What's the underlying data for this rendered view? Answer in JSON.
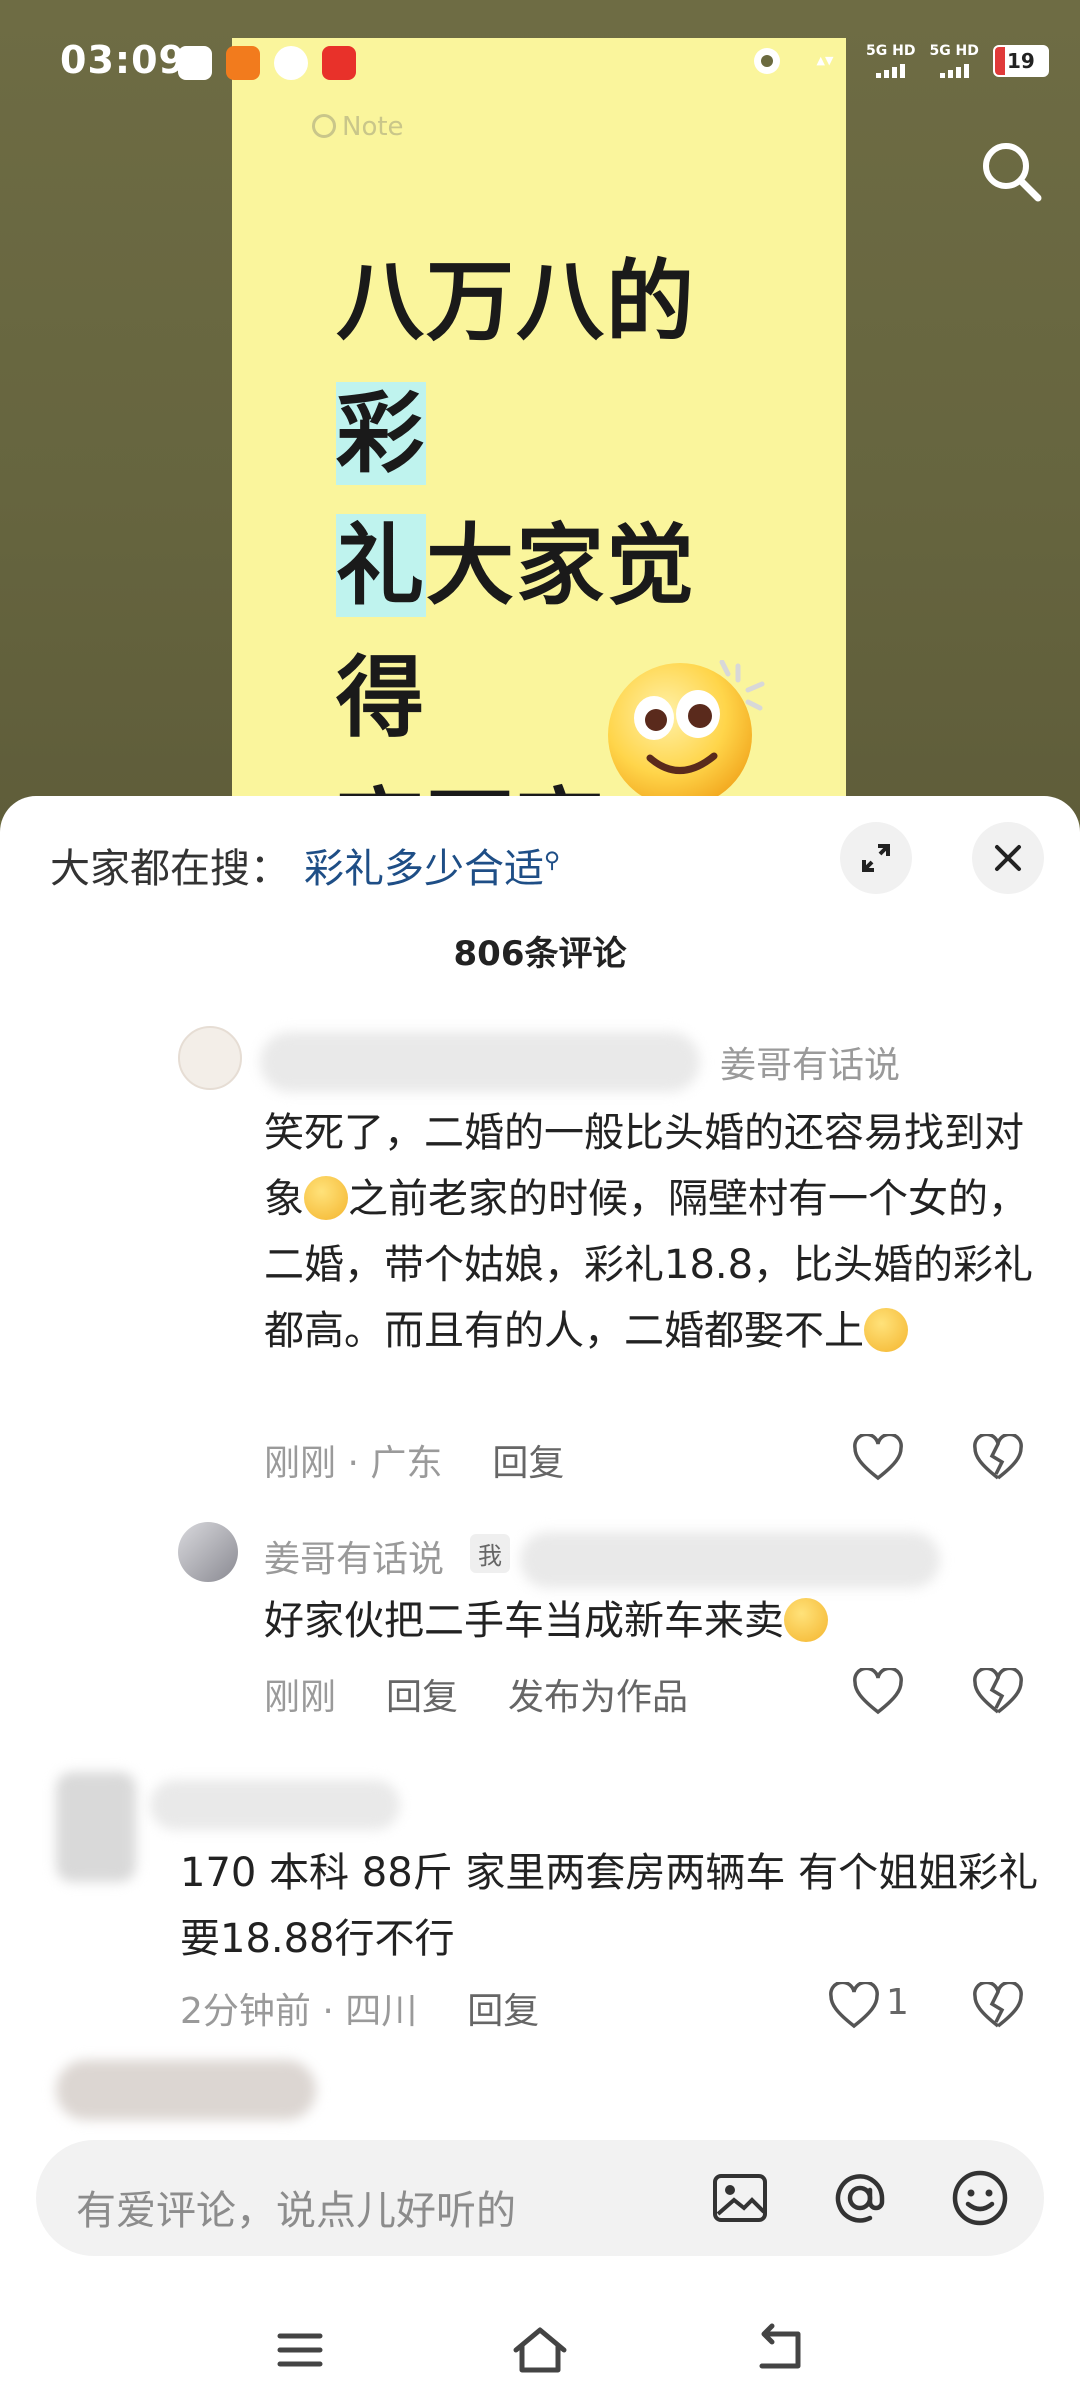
{
  "status_bar": {
    "time": "03:09",
    "signal_1": "5G HD",
    "signal_2": "5G HD",
    "battery": "19"
  },
  "video": {
    "note_tag": "Note",
    "headline_line1_a": "八万八的",
    "headline_line1_b": "彩",
    "headline_line2_a": "礼",
    "headline_line2_b": "大家觉得",
    "headline_line3": "高不高"
  },
  "sheet": {
    "search_prefix": "大家都在搜：",
    "search_keyword": "彩礼多少合适",
    "comment_count": "806条评论"
  },
  "comments": [
    {
      "reply_to": "姜哥有话说",
      "text_1": "笑死了，二婚的一般比头婚的还容易找到对象",
      "text_2": "之前老家的时候，隔壁村有一个女的，二婚，带个姑娘，彩礼18.8，比头婚的彩礼都高。而且有的人，二婚都娶不上",
      "time": "刚刚 · 广东",
      "reply": "回复"
    },
    {
      "author": "姜哥有话说",
      "author_tag": "我",
      "text": "好家伙把二手车当成新车来卖",
      "time": "刚刚",
      "reply": "回复",
      "publish": "发布为作品"
    },
    {
      "text": "170 本科 88斤 家里两套房两辆车 有个姐姐彩礼要18.88行不行",
      "time": "2分钟前 · 四川",
      "reply": "回复",
      "likes": "1"
    }
  ],
  "input": {
    "placeholder": "有爱评论，说点儿好听的"
  },
  "colors": {
    "note_bg": "#faf59c",
    "highlight": "#bff3ee",
    "keyword": "#1e4e86"
  }
}
